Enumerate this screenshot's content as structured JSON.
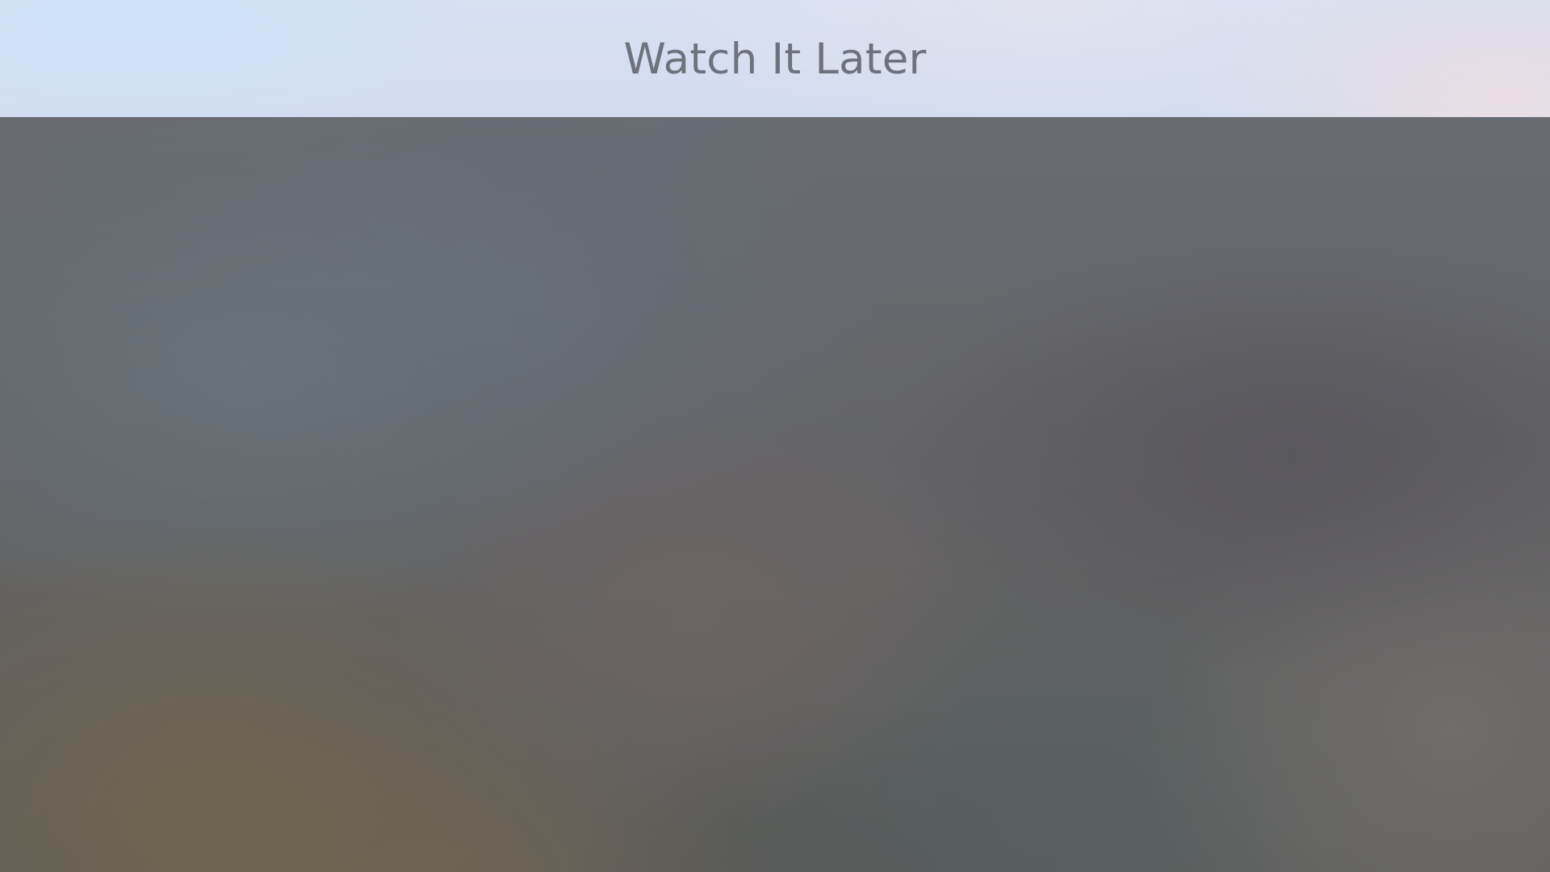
{
  "header": {
    "title": "Watch It Later"
  },
  "colors": {
    "header_background": "#d4deef",
    "title_text": "#6d737d",
    "content_background": "#646466"
  }
}
